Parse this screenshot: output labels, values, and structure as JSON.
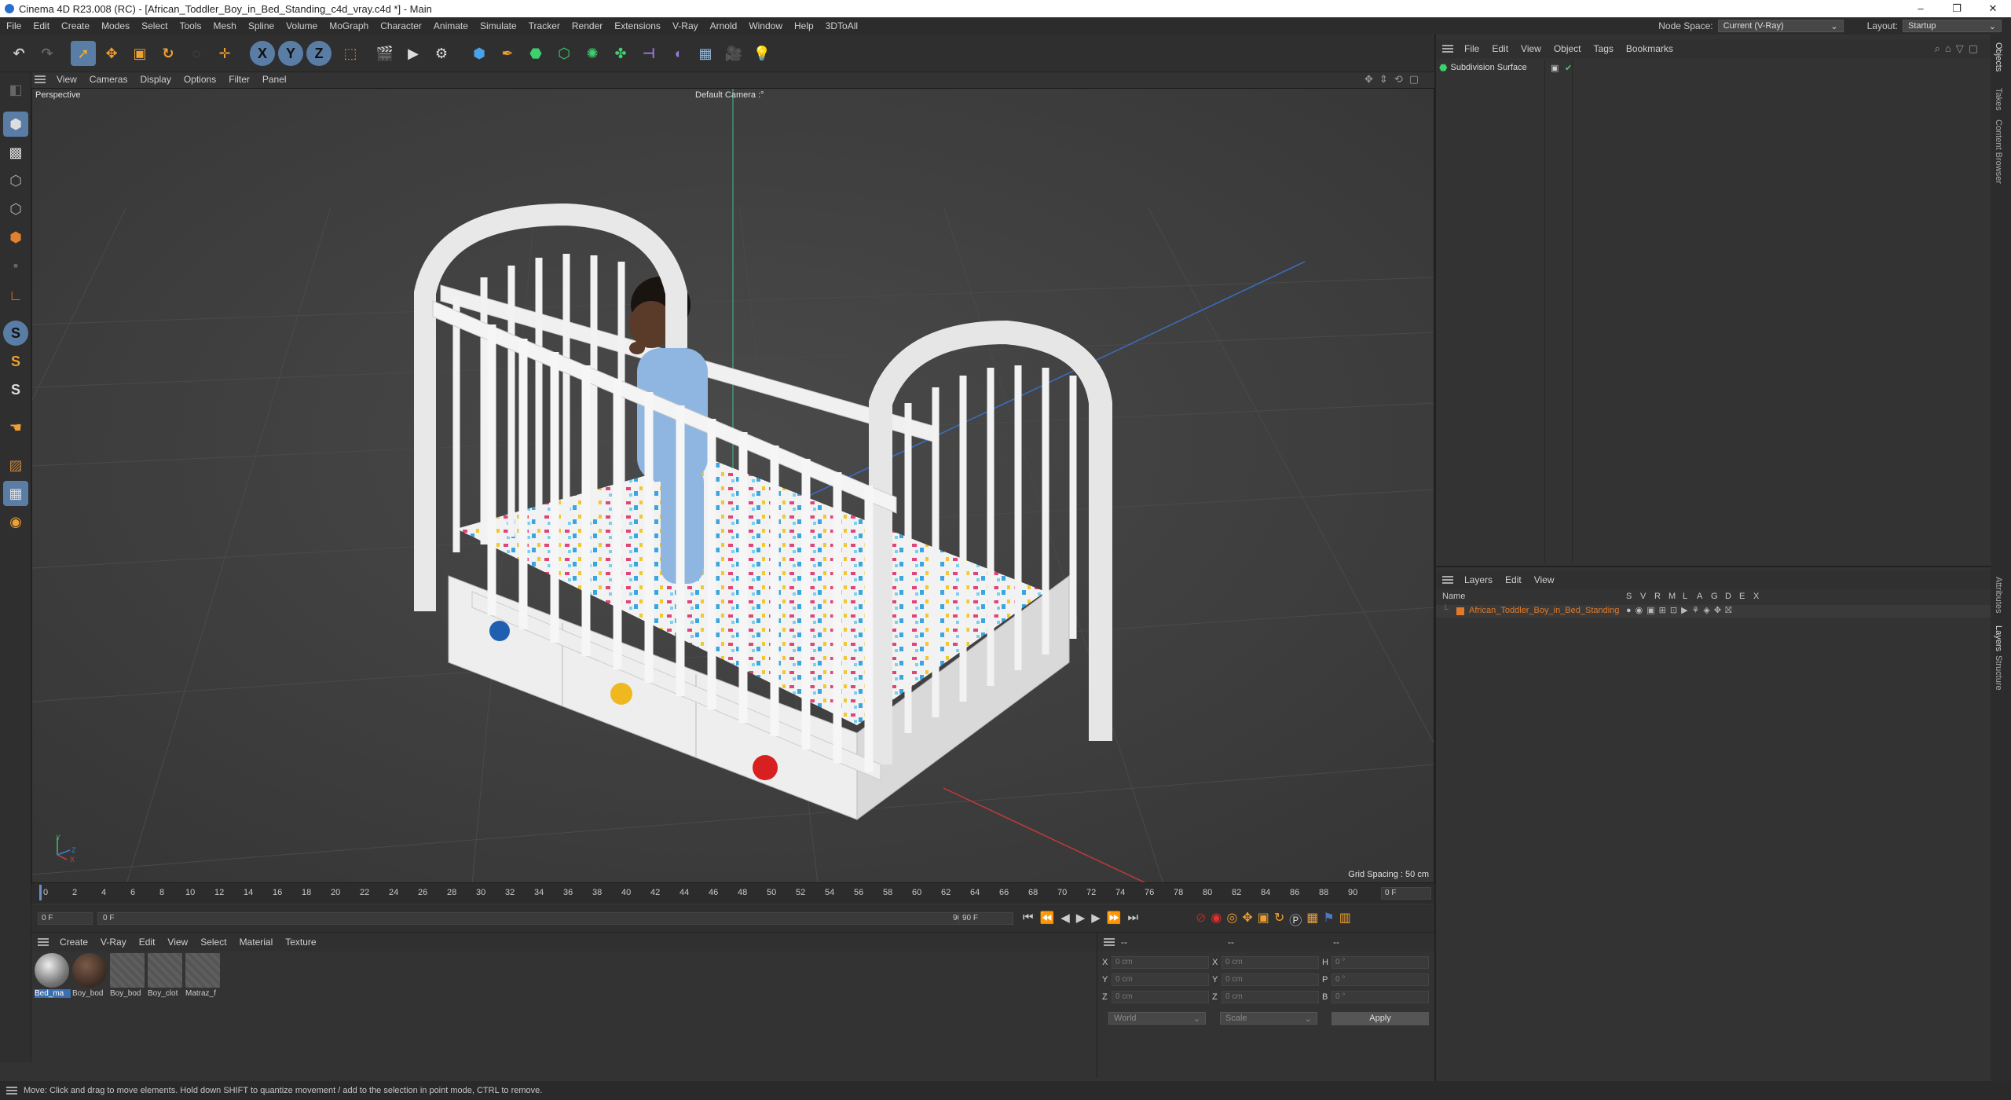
{
  "titlebar": {
    "title": "Cinema 4D R23.008 (RC) - [African_Toddler_Boy_in_Bed_Standing_c4d_vray.c4d *] - Main",
    "minimize": "–",
    "restore": "❐",
    "close": "✕"
  },
  "menubar": {
    "items": [
      "File",
      "Edit",
      "Create",
      "Modes",
      "Select",
      "Tools",
      "Mesh",
      "Spline",
      "Volume",
      "MoGraph",
      "Character",
      "Animate",
      "Simulate",
      "Tracker",
      "Render",
      "Extensions",
      "V-Ray",
      "Arnold",
      "Window",
      "Help",
      "3DToAll"
    ],
    "node_space_label": "Node Space:",
    "node_space_value": "Current (V-Ray)",
    "layout_label": "Layout:",
    "layout_value": "Startup"
  },
  "toolbar": {
    "axis_x": "X",
    "axis_y": "Y",
    "axis_z": "Z"
  },
  "lefttoolbar": {
    "s1": "S",
    "s2": "S",
    "s3": "S"
  },
  "viewport": {
    "menu": [
      "View",
      "Cameras",
      "Display",
      "Options",
      "Filter",
      "Panel"
    ],
    "view_name": "Perspective",
    "camera": "Default Camera",
    "camera_mark": ":°",
    "grid_spacing": "Grid Spacing : 50 cm",
    "axis_y": "Y",
    "axis_z": "Z",
    "axis_x": "X"
  },
  "timeline": {
    "ticks": [
      "0",
      "2",
      "4",
      "6",
      "8",
      "10",
      "12",
      "14",
      "16",
      "18",
      "20",
      "22",
      "24",
      "26",
      "28",
      "30",
      "32",
      "34",
      "36",
      "38",
      "40",
      "42",
      "44",
      "46",
      "48",
      "50",
      "52",
      "54",
      "56",
      "58",
      "60",
      "62",
      "64",
      "66",
      "68",
      "70",
      "72",
      "74",
      "76",
      "78",
      "80",
      "82",
      "84",
      "86",
      "88",
      "90"
    ],
    "current_frame": "0 F"
  },
  "transport": {
    "start_frame": "0 F",
    "slider_start": "0 F",
    "slider_end": "90 F",
    "end_frame": "90 F"
  },
  "materials": {
    "menu": [
      "Create",
      "V-Ray",
      "Edit",
      "View",
      "Select",
      "Material",
      "Texture"
    ],
    "items": [
      {
        "label": "Bed_ma",
        "color": "#9a9a9a"
      },
      {
        "label": "Boy_bod",
        "color": "#4a3a32"
      },
      {
        "label": "Boy_bod",
        "color": "#5a5a5a"
      },
      {
        "label": "Boy_clot",
        "color": "#5a5a5a"
      },
      {
        "label": "Matraz_f",
        "color": "#5a5a5a"
      }
    ]
  },
  "coords": {
    "header": "--",
    "header2": "--",
    "header3": "--",
    "rows": [
      {
        "a": "X",
        "av": "0 cm",
        "b": "X",
        "bv": "0 cm",
        "c": "H",
        "cv": "0 °"
      },
      {
        "a": "Y",
        "av": "0 cm",
        "b": "Y",
        "bv": "0 cm",
        "c": "P",
        "cv": "0 °"
      },
      {
        "a": "Z",
        "av": "0 cm",
        "b": "Z",
        "bv": "0 cm",
        "c": "B",
        "cv": "0 °"
      }
    ],
    "world": "World",
    "scale": "Scale",
    "apply": "Apply"
  },
  "objects": {
    "menu": [
      "File",
      "Edit",
      "View",
      "Object",
      "Tags",
      "Bookmarks"
    ],
    "item": "Subdivision Surface"
  },
  "layers": {
    "menu": [
      "Layers",
      "Edit",
      "View"
    ],
    "col_name": "Name",
    "cols": [
      "S",
      "V",
      "R",
      "M",
      "L",
      "A",
      "G",
      "D",
      "E",
      "X"
    ],
    "item": "African_Toddler_Boy_in_Bed_Standing",
    "item_color": "#e07a2a"
  },
  "right_tabs": {
    "top": [
      "Objects",
      "Takes",
      "Content Browser"
    ],
    "bottom": [
      "Attributes",
      "Layers",
      "Structure"
    ]
  },
  "status": "Move: Click and drag to move elements. Hold down SHIFT to quantize movement / add to the selection in point mode, CTRL to remove."
}
